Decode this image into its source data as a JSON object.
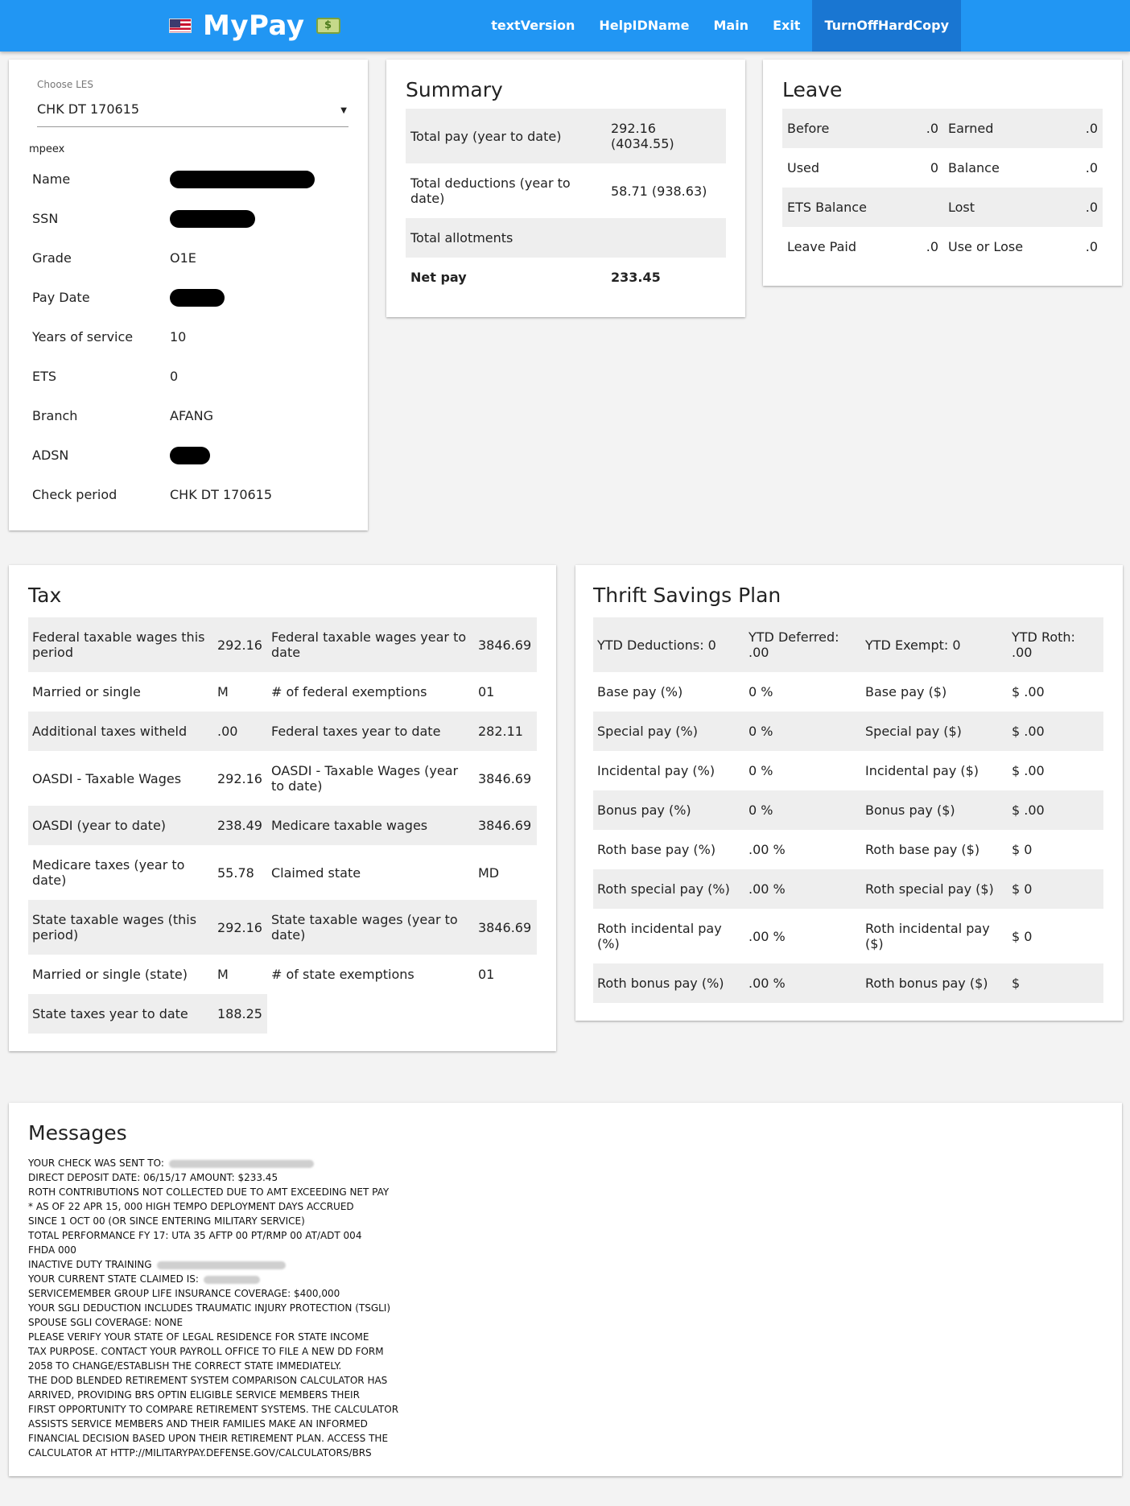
{
  "header": {
    "brand": "MyPay",
    "nav": [
      "textVersion",
      "HelpIDName",
      "Main",
      "Exit",
      "TurnOffHardCopy"
    ]
  },
  "info": {
    "les_label": "Choose LES",
    "les_value": "CHK DT  170615",
    "mpeex": "mpeex",
    "rows": [
      {
        "label": "Name",
        "value": ""
      },
      {
        "label": "SSN",
        "value": ""
      },
      {
        "label": "Grade",
        "value": "O1E"
      },
      {
        "label": "Pay Date",
        "value": ""
      },
      {
        "label": "Years of service",
        "value": "10"
      },
      {
        "label": "ETS",
        "value": "0"
      },
      {
        "label": "Branch",
        "value": "AFANG"
      },
      {
        "label": "ADSN",
        "value": ""
      },
      {
        "label": "Check period",
        "value": "CHK DT 170615"
      }
    ]
  },
  "summary": {
    "title": "Summary",
    "rows": [
      {
        "label": "Total pay (year to date)",
        "value": "292.16 (4034.55)"
      },
      {
        "label": "Total deductions (year to date)",
        "value": "58.71 (938.63)"
      },
      {
        "label": "Total allotments",
        "value": ""
      },
      {
        "label": "Net pay",
        "value": "233.45"
      }
    ]
  },
  "leave": {
    "title": "Leave",
    "rows": [
      [
        "Before",
        ".0",
        "Earned",
        ".0"
      ],
      [
        "Used",
        "0",
        "Balance",
        ".0"
      ],
      [
        "ETS Balance",
        "",
        "Lost",
        ".0"
      ],
      [
        "Leave Paid",
        ".0",
        "Use or Lose",
        ".0"
      ]
    ]
  },
  "tax": {
    "title": "Tax",
    "rows": [
      [
        "Federal taxable wages this period",
        "292.16",
        "Federal taxable wages year to date",
        "3846.69"
      ],
      [
        "Married or single",
        "M",
        "# of federal exemptions",
        "01"
      ],
      [
        "Additional taxes witheld",
        ".00",
        "Federal taxes year to date",
        "282.11"
      ],
      [
        "OASDI - Taxable Wages",
        "292.16",
        "OASDI - Taxable Wages (year to date)",
        "3846.69"
      ],
      [
        "OASDI (year to date)",
        "238.49",
        "Medicare taxable wages",
        "3846.69"
      ],
      [
        "Medicare taxes (year to date)",
        "55.78",
        "Claimed state",
        "MD"
      ],
      [
        "State taxable wages (this period)",
        "292.16",
        "State taxable wages (year to date)",
        "3846.69"
      ],
      [
        "Married or single (state)",
        "M",
        "# of state exemptions",
        "01"
      ],
      [
        "State taxes year to date",
        "188.25"
      ]
    ]
  },
  "tsp": {
    "title": "Thrift Savings Plan",
    "rows": [
      [
        "YTD Deductions: 0",
        "YTD Deferred: .00",
        "YTD Exempt: 0",
        "YTD Roth: .00"
      ],
      [
        "Base pay (%)",
        "0 %",
        "Base pay ($)",
        "$ .00"
      ],
      [
        "Special pay (%)",
        "0 %",
        "Special pay ($)",
        "$ .00"
      ],
      [
        "Incidental pay (%)",
        "0 %",
        "Incidental pay ($)",
        "$ .00"
      ],
      [
        "Bonus pay (%)",
        "0 %",
        "Bonus pay ($)",
        "$ .00"
      ],
      [
        "Roth base pay (%)",
        ".00 %",
        "Roth base pay ($)",
        "$ 0"
      ],
      [
        "Roth special pay (%)",
        ".00 %",
        "Roth special pay ($)",
        "$ 0"
      ],
      [
        "Roth incidental pay (%)",
        ".00 %",
        "Roth incidental pay ($)",
        "$ 0"
      ],
      [
        "Roth bonus pay (%)",
        ".00 %",
        "Roth bonus pay ($)",
        "$"
      ]
    ]
  },
  "messages": {
    "title": "Messages",
    "lines": [
      "YOUR CHECK WAS SENT TO:",
      "DIRECT DEPOSIT DATE: 06/15/17 AMOUNT: $233.45",
      "ROTH CONTRIBUTIONS NOT COLLECTED DUE TO AMT EXCEEDING NET PAY",
      "* AS OF 22 APR 15, 000 HIGH TEMPO DEPLOYMENT DAYS ACCRUED",
      "SINCE 1 OCT 00 (OR SINCE ENTERING MILITARY SERVICE)",
      "TOTAL PERFORMANCE FY 17: UTA 35 AFTP 00 PT/RMP 00 AT/ADT 004",
      "FHDA 000",
      "INACTIVE DUTY TRAINING",
      "YOUR CURRENT STATE CLAIMED IS:",
      "SERVICEMEMBER GROUP LIFE INSURANCE COVERAGE: $400,000",
      "YOUR SGLI DEDUCTION INCLUDES TRAUMATIC INJURY PROTECTION (TSGLI)",
      "SPOUSE SGLI COVERAGE: NONE",
      "PLEASE VERIFY YOUR STATE OF LEGAL RESIDENCE FOR STATE INCOME",
      "TAX PURPOSE. CONTACT YOUR PAYROLL OFFICE TO FILE A NEW DD FORM",
      "2058 TO CHANGE/ESTABLISH THE CORRECT STATE IMMEDIATELY.",
      "THE DOD BLENDED RETIREMENT SYSTEM COMPARISON CALCULATOR HAS",
      "ARRIVED, PROVIDING BRS OPTIN ELIGIBLE SERVICE MEMBERS THEIR",
      "FIRST OPPORTUNITY TO COMPARE RETIREMENT SYSTEMS. THE CALCULATOR",
      "ASSISTS SERVICE MEMBERS AND THEIR FAMILIES MAKE AN INFORMED",
      "FINANCIAL DECISION BASED UPON THEIR RETIREMENT PLAN. ACCESS THE",
      "CALCULATOR AT HTTP://MILITARYPAY.DEFENSE.GOV/CALCULATORS/BRS"
    ]
  }
}
